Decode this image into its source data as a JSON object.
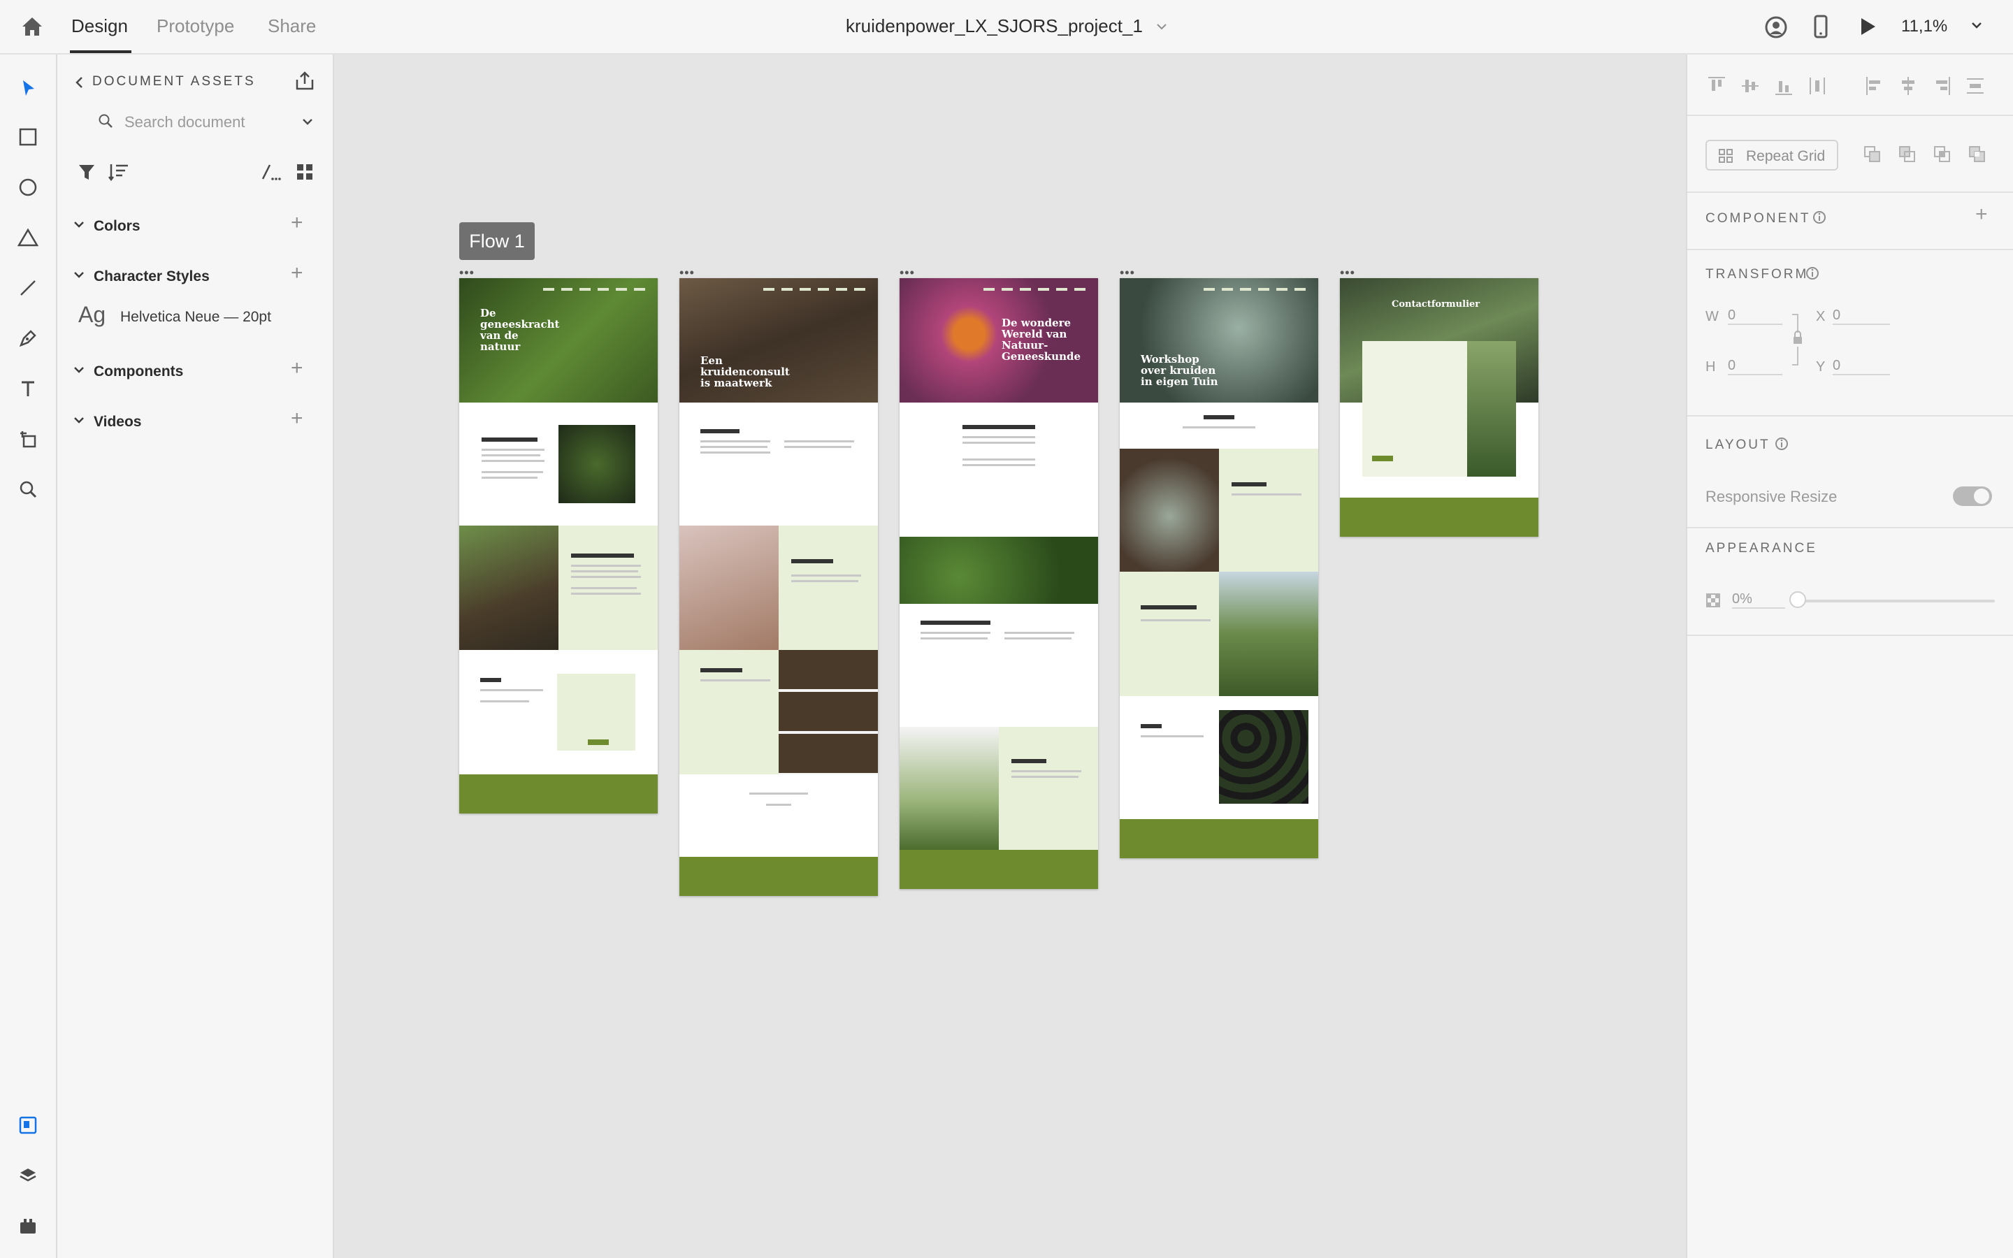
{
  "topbar": {
    "tabs": [
      {
        "label": "Design"
      },
      {
        "label": "Prototype"
      },
      {
        "label": "Share"
      }
    ],
    "document_title": "kruidenpower_LX_SJORS_project_1",
    "zoom": "11,1%"
  },
  "assets": {
    "header": "DOCUMENT ASSETS",
    "search_placeholder": "Search document",
    "sections": {
      "colors": "Colors",
      "character_styles": "Character Styles",
      "components": "Components",
      "videos": "Videos"
    },
    "character_style": {
      "sample": "Ag",
      "name": "Helvetica Neue — 20pt"
    }
  },
  "canvas": {
    "flow_label": "Flow 1",
    "artboards": [
      {
        "hero_title": "De geneeskracht van de natuur"
      },
      {
        "hero_title": "Een kruidenconsult is maatwerk"
      },
      {
        "hero_title": "De wondere Wereld van Natuur-Geneeskunde"
      },
      {
        "hero_title": "Workshop over kruiden in eigen Tuin"
      },
      {
        "hero_title": "Contactformulier"
      }
    ]
  },
  "right_panel": {
    "repeat_grid": "Repeat Grid",
    "component": "COMPONENT",
    "transform": "TRANSFORM",
    "w_label": "W",
    "w_value": "0",
    "x_label": "X",
    "x_value": "0",
    "h_label": "H",
    "h_value": "0",
    "y_label": "Y",
    "y_value": "0",
    "layout": "LAYOUT",
    "responsive_resize": "Responsive Resize",
    "appearance": "APPEARANCE",
    "opacity": "0%"
  },
  "colors": {
    "accent_blue": "#1473e6",
    "brand_green": "#6e8b2d",
    "light_green": "#e8f0d9"
  }
}
